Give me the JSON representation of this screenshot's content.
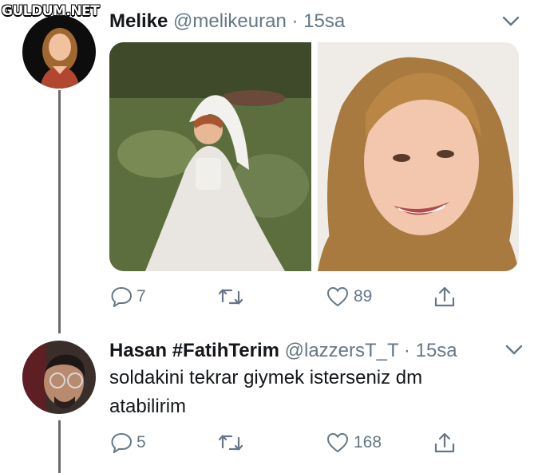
{
  "watermark": "GULDUM.NET",
  "tweet1": {
    "name": "Melike",
    "handle": "@melikeuran",
    "dot": "·",
    "time": "15sa",
    "actions": {
      "replies": "7",
      "retweets": "",
      "likes": "89"
    }
  },
  "tweet2": {
    "name": "Hasan #FatihTerim",
    "handle": "@lazzersT_T",
    "dot": "·",
    "time": "15sa",
    "text": "soldakini tekrar giymek isterseniz dm atabilirim",
    "actions": {
      "replies": "5",
      "retweets": "",
      "likes": "168"
    }
  },
  "icons": {
    "reply": "reply-icon",
    "retweet": "retweet-icon",
    "like": "heart-icon",
    "share": "share-icon",
    "caret": "chevron-down-icon"
  },
  "colors": {
    "icon": "#657786",
    "thread": "#6a6a6a",
    "text": "#14171a"
  }
}
